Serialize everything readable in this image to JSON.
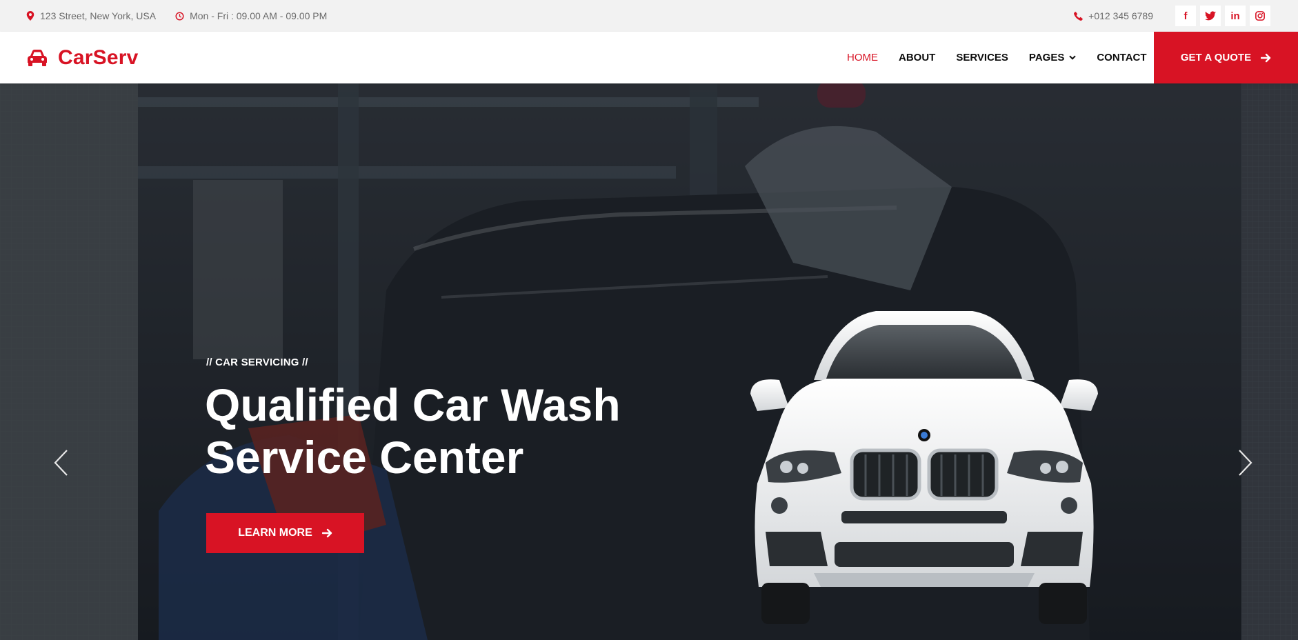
{
  "topbar": {
    "address": "123 Street, New York, USA",
    "hours": "Mon - Fri : 09.00 AM - 09.00 PM",
    "phone": "+012 345 6789",
    "social": [
      {
        "icon": "facebook-icon",
        "glyph": "f"
      },
      {
        "icon": "twitter-icon",
        "glyph": "t"
      },
      {
        "icon": "linkedin-icon",
        "glyph": "in"
      },
      {
        "icon": "instagram-icon",
        "glyph": "◎"
      }
    ]
  },
  "brand": {
    "name": "CarServ",
    "color": "#d81324"
  },
  "nav": {
    "items": [
      {
        "label": "HOME",
        "active": true
      },
      {
        "label": "ABOUT"
      },
      {
        "label": "SERVICES"
      },
      {
        "label": "PAGES"
      },
      {
        "label": "CONTACT"
      }
    ],
    "cta": "GET A QUOTE"
  },
  "hero": {
    "kicker": "// CAR SERVICING //",
    "title": "Qualified Car Wash Service Center",
    "button": "LEARN MORE"
  }
}
